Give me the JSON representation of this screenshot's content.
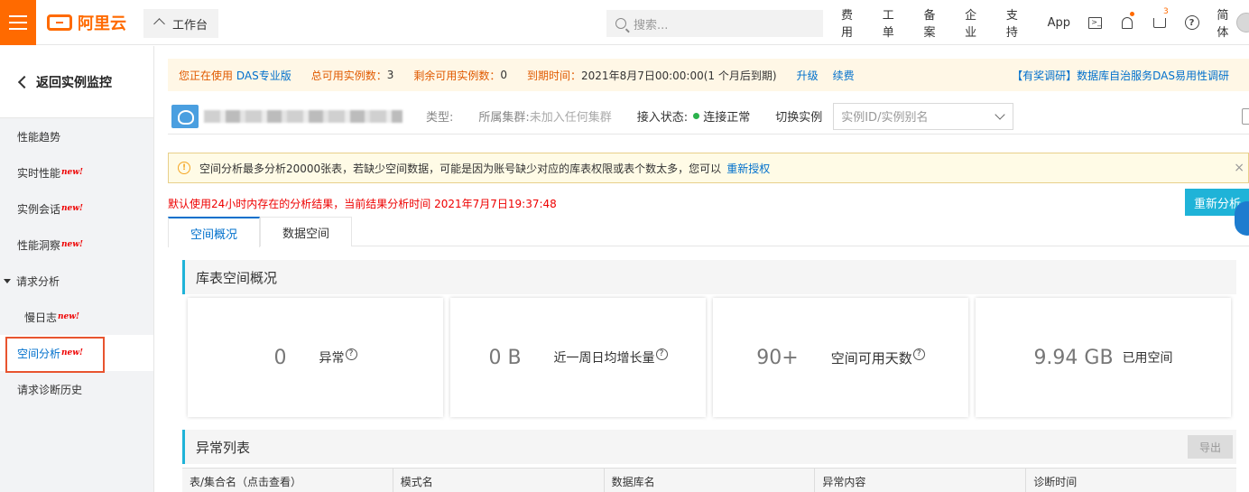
{
  "topbar": {
    "logo_text": "阿里云",
    "workbench_label": "工作台",
    "search_placeholder": "搜索...",
    "nav": [
      "费用",
      "工单",
      "备案",
      "企业",
      "支持",
      "App"
    ],
    "cart_badge": "3",
    "lang_label": "简体"
  },
  "sidebar": {
    "back_label": "返回实例监控",
    "items": [
      {
        "label": "性能趋势",
        "new": false
      },
      {
        "label": "实时性能",
        "new": true
      },
      {
        "label": "实例会话",
        "new": true
      },
      {
        "label": "性能洞察",
        "new": true
      }
    ],
    "group_label": "请求分析",
    "sub_items": [
      {
        "label": "慢日志",
        "new": true
      }
    ],
    "active_item": {
      "label": "空间分析",
      "new": true
    },
    "after_items": [
      {
        "label": "请求诊断历史",
        "new": false
      }
    ],
    "new_badge_text": "new!"
  },
  "notice": {
    "using_prefix": "您正在使用",
    "edition_link": "DAS专业版",
    "total_label": "总可用实例数：",
    "total_value": "3",
    "remaining_label": "剩余可用实例数：",
    "remaining_value": "0",
    "expire_label": "到期时间：",
    "expire_value": "2021年8月7日00:00:00(1 个月后到期)",
    "upgrade_link": "升级",
    "renew_link": "续费",
    "survey_link": "【有奖调研】数据库自治服务DAS易用性调研"
  },
  "instance": {
    "type_label": "类型:",
    "cluster_label": "所属集群:",
    "cluster_value": "未加入任何集群",
    "status_label": "接入状态:",
    "status_value": "连接正常",
    "switch_label": "切换实例",
    "select_placeholder": "实例ID/实例别名"
  },
  "warning": {
    "text": "空间分析最多分析20000张表，若缺少空间数据，可能是因为账号缺少对应的库表权限或表个数太多，您可以",
    "link": "重新授权",
    "close": "×"
  },
  "result_note": "默认使用24小时内存在的分析结果，当前结果分析时间 2021年7月7日19:37:48",
  "reanalyze_label": "重新分析",
  "tabs": [
    {
      "label": "空间概况",
      "active": true
    },
    {
      "label": "数据空间",
      "active": false
    }
  ],
  "overview": {
    "title": "库表空间概况",
    "cards": [
      {
        "value": "0",
        "label": "异常",
        "help": true
      },
      {
        "value": "0 B",
        "label": "近一周日均增长量",
        "help": true
      },
      {
        "value": "90+",
        "label": "空间可用天数",
        "help": true
      },
      {
        "value": "9.94 GB",
        "label": "已用空间",
        "help": false
      }
    ]
  },
  "anomaly": {
    "title": "异常列表",
    "export_label": "导出",
    "columns": [
      "表/集合名（点击查看）",
      "模式名",
      "数据库名",
      "异常内容",
      "诊断时间"
    ]
  },
  "colors": {
    "brand_orange": "#ff6a00",
    "link_blue": "#0070cc",
    "accent_cyan": "#1fb3d8",
    "highlight_red": "#e8542f"
  }
}
